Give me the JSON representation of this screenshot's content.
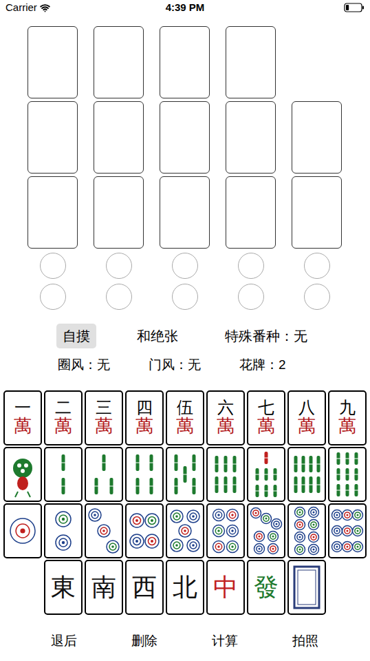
{
  "status_bar": {
    "carrier": "Carrier",
    "time": "4:39 PM",
    "battery_level": 0.2
  },
  "hand_rows": [
    {
      "slots": 4
    },
    {
      "slots": 5
    },
    {
      "slots": 5
    }
  ],
  "flower_rows": [
    {
      "circles": 5
    },
    {
      "circles": 5
    }
  ],
  "options": [
    {
      "label": "自摸",
      "selected": true
    },
    {
      "label": "和绝张",
      "selected": false
    },
    {
      "label": "特殊番种：无",
      "selected": false
    }
  ],
  "settings": [
    {
      "label": "圈风：无"
    },
    {
      "label": "门风：无"
    },
    {
      "label": "花牌：2"
    }
  ],
  "keyboard": {
    "rows": [
      [
        {
          "kind": "character",
          "numeral": "一",
          "suit": "萬"
        },
        {
          "kind": "character",
          "numeral": "二",
          "suit": "萬"
        },
        {
          "kind": "character",
          "numeral": "三",
          "suit": "萬"
        },
        {
          "kind": "character",
          "numeral": "四",
          "suit": "萬"
        },
        {
          "kind": "character",
          "numeral": "伍",
          "suit": "萬"
        },
        {
          "kind": "character",
          "numeral": "六",
          "suit": "萬"
        },
        {
          "kind": "character",
          "numeral": "七",
          "suit": "萬"
        },
        {
          "kind": "character",
          "numeral": "八",
          "suit": "萬"
        },
        {
          "kind": "character",
          "numeral": "九",
          "suit": "萬"
        }
      ],
      [
        {
          "kind": "bamboo",
          "rank": 1
        },
        {
          "kind": "bamboo",
          "rank": 2
        },
        {
          "kind": "bamboo",
          "rank": 3
        },
        {
          "kind": "bamboo",
          "rank": 4
        },
        {
          "kind": "bamboo",
          "rank": 5
        },
        {
          "kind": "bamboo",
          "rank": 6
        },
        {
          "kind": "bamboo",
          "rank": 7
        },
        {
          "kind": "bamboo",
          "rank": 8
        },
        {
          "kind": "bamboo",
          "rank": 9
        }
      ],
      [
        {
          "kind": "dot",
          "rank": 1
        },
        {
          "kind": "dot",
          "rank": 2
        },
        {
          "kind": "dot",
          "rank": 3
        },
        {
          "kind": "dot",
          "rank": 4
        },
        {
          "kind": "dot",
          "rank": 5
        },
        {
          "kind": "dot",
          "rank": 6
        },
        {
          "kind": "dot",
          "rank": 7
        },
        {
          "kind": "dot",
          "rank": 8
        },
        {
          "kind": "dot",
          "rank": 9
        }
      ],
      [
        {
          "kind": "honor",
          "text": "東",
          "color": "#111111"
        },
        {
          "kind": "honor",
          "text": "南",
          "color": "#111111"
        },
        {
          "kind": "honor",
          "text": "西",
          "color": "#111111"
        },
        {
          "kind": "honor",
          "text": "北",
          "color": "#111111"
        },
        {
          "kind": "honor",
          "text": "中",
          "color": "#c0201e"
        },
        {
          "kind": "honor",
          "text": "發",
          "color": "#1e7a2e"
        },
        {
          "kind": "white"
        }
      ]
    ]
  },
  "actions": [
    "退后",
    "删除",
    "计算",
    "拍照"
  ]
}
